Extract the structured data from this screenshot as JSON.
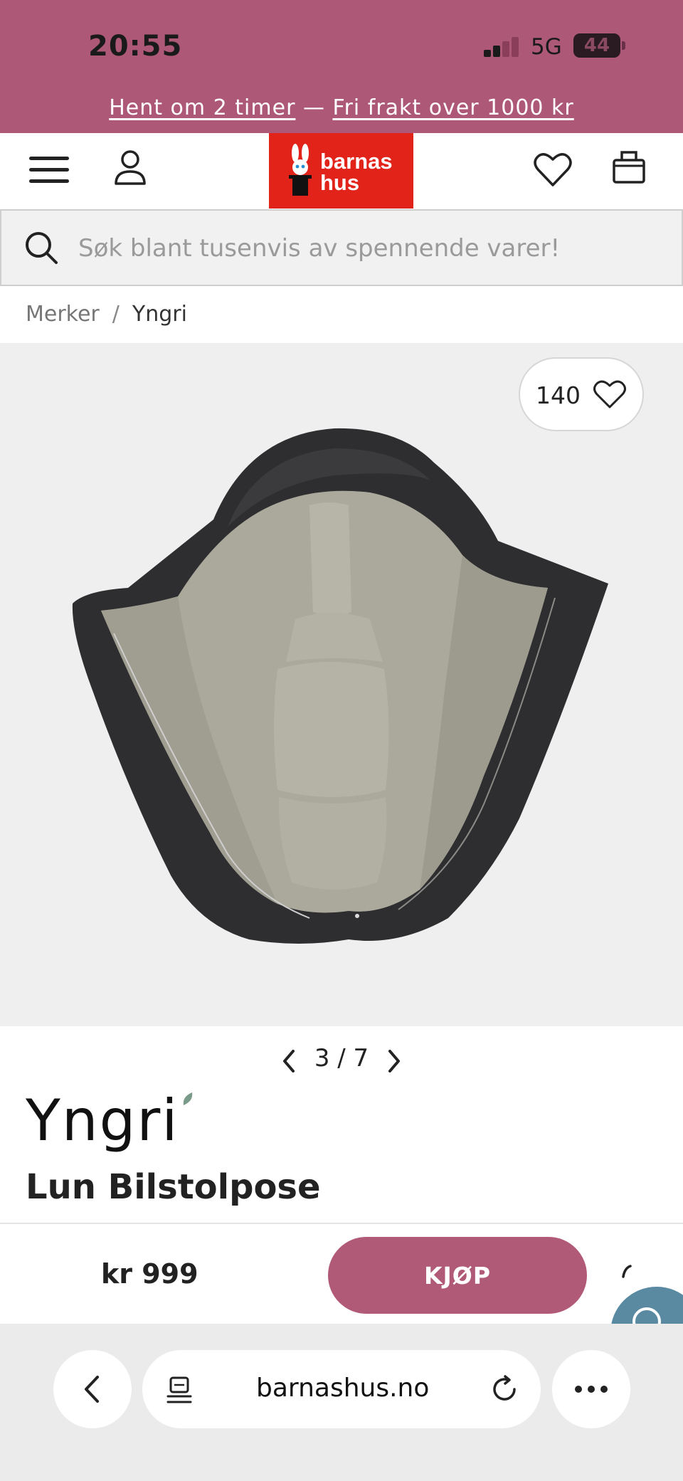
{
  "status_bar": {
    "time": "20:55",
    "network": "5G",
    "battery": "44"
  },
  "promo": {
    "pickup_link": "Hent om 2 timer",
    "separator": "—",
    "shipping_link": "Fri frakt over 1000 kr"
  },
  "logo": {
    "line1": "barnas",
    "line2": "hus"
  },
  "search": {
    "placeholder": "Søk blant tusenvis av spennende varer!"
  },
  "breadcrumb": {
    "items": [
      "Merker",
      "Yngri"
    ],
    "separator": "/"
  },
  "gallery": {
    "favorites_count": "140",
    "current": "3",
    "total": "7",
    "pager_separator": "/"
  },
  "product": {
    "brand": "Yngri",
    "title": "Lun Bilstolpose",
    "price": "kr 999",
    "buy_label": "KJØP"
  },
  "browser": {
    "url": "barnashus.no"
  },
  "colors": {
    "brand_pink": "#ad5876",
    "logo_red": "#e2231a",
    "buy_button": "#b05a77",
    "lining_beige": "#a9a89a",
    "shell_dark": "#2e2e30"
  }
}
